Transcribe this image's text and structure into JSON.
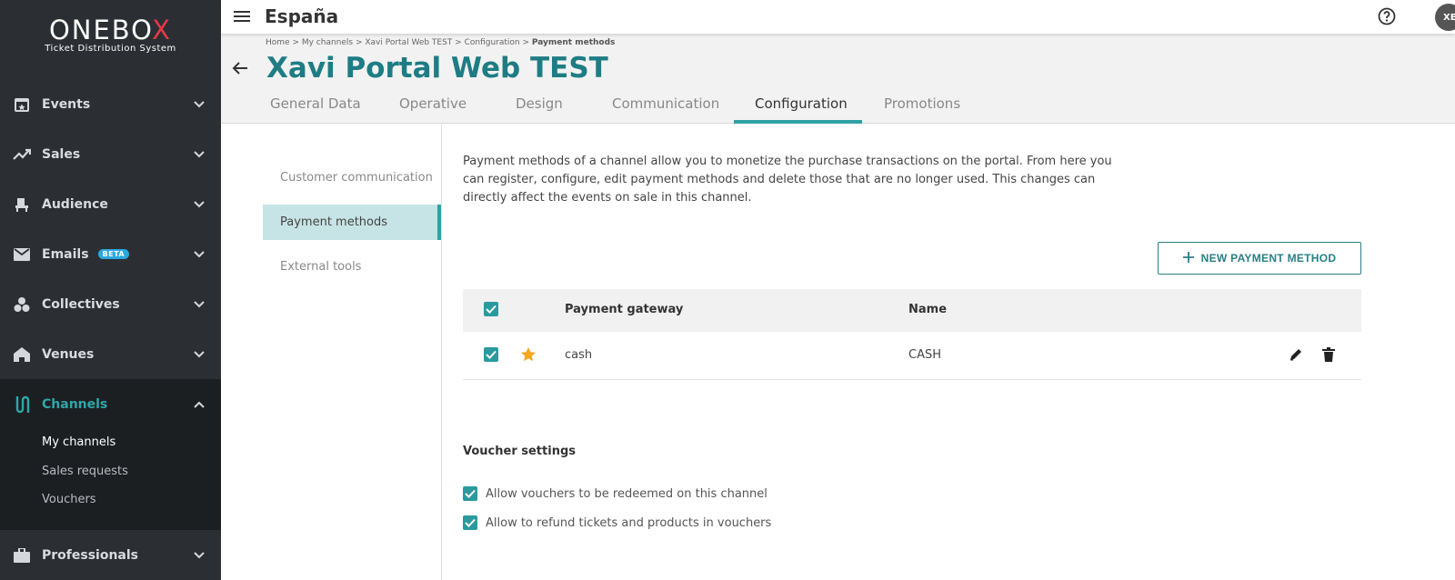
{
  "brand": {
    "name_main": "ONEBO",
    "name_x": "X",
    "tagline": "Ticket Distribution System"
  },
  "sidebar": {
    "items": [
      {
        "label": "Events",
        "icon": "calendar-star-icon"
      },
      {
        "label": "Sales",
        "icon": "trending-up-icon"
      },
      {
        "label": "Audience",
        "icon": "seat-icon"
      },
      {
        "label": "Emails",
        "icon": "mail-icon",
        "badge": "BETA"
      },
      {
        "label": "Collectives",
        "icon": "group-icon"
      },
      {
        "label": "Venues",
        "icon": "venue-icon"
      },
      {
        "label": "Channels",
        "icon": "channels-icon",
        "active": true
      },
      {
        "label": "Professionals",
        "icon": "briefcase-icon"
      }
    ],
    "channels_sub": [
      "My channels",
      "Sales requests",
      "Vouchers"
    ]
  },
  "topbar": {
    "country": "España",
    "avatar": "XE"
  },
  "breadcrumb": {
    "path": "Home > My channels > Xavi Portal Web TEST > Configuration > ",
    "current": "Payment methods"
  },
  "page": {
    "title": "Xavi Portal Web TEST"
  },
  "tabs": [
    "General Data",
    "Operative",
    "Design",
    "Communication",
    "Configuration",
    "Promotions"
  ],
  "active_tab": "Configuration",
  "subnav": [
    "Customer communication",
    "Payment methods",
    "External tools"
  ],
  "content": {
    "description": "Payment methods of a channel allow you to monetize the purchase transactions on the portal. From here you can register, configure, edit payment methods and delete those that are no longer used. This changes can directly affect the events on sale in this channel.",
    "new_button": "NEW PAYMENT METHOD",
    "table": {
      "headers": [
        "Payment gateway",
        "Name"
      ],
      "rows": [
        {
          "gateway": "cash",
          "name": "CASH",
          "checked": true,
          "default": true
        }
      ]
    },
    "voucher_title": "Voucher settings",
    "voucher_options": [
      "Allow vouchers to be redeemed on this channel",
      "Allow to refund tickets and products in vouchers"
    ]
  },
  "colors": {
    "accent": "#2fa1a5",
    "title": "#1e7c84",
    "sidebar": "#2b2f33",
    "star": "#f5a623"
  }
}
